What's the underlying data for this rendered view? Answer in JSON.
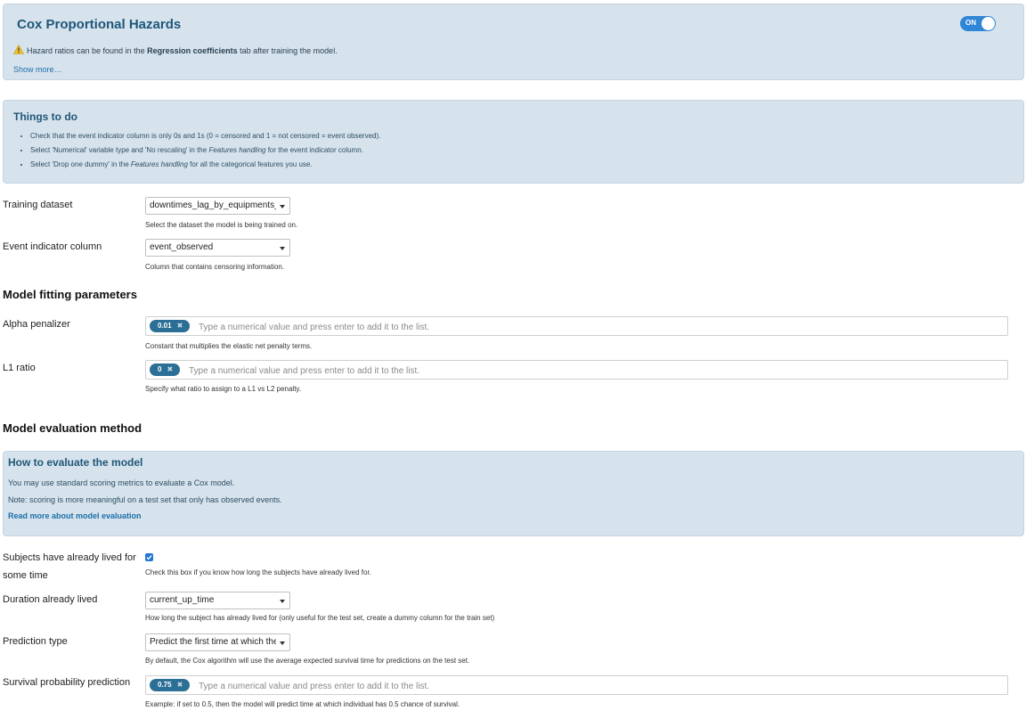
{
  "header": {
    "title": "Cox Proportional Hazards",
    "toggle_label": "ON",
    "warning_before": "Hazard ratios can be found in the ",
    "warning_bold": "Regression coefficients",
    "warning_after": " tab after training the model.",
    "show_more": "Show more…"
  },
  "todo": {
    "title": "Things to do",
    "items": [
      {
        "text": "Check that the event indicator column is only 0s and 1s (0 = censored and 1 = not censored = event observed)."
      },
      {
        "before": "Select 'Numerical' variable type and 'No rescaling' in the ",
        "em": "Features handling",
        "after": " for the event indicator column."
      },
      {
        "before": "Select 'Drop one dummy' in the ",
        "em": "Features handling",
        "after": " for all the categorical features you use."
      }
    ]
  },
  "training_dataset": {
    "label": "Training dataset",
    "value": "downtimes_lag_by_equipments_",
    "help": "Select the dataset the model is being trained on."
  },
  "event_indicator": {
    "label": "Event indicator column",
    "value": "event_observed",
    "help": "Column that contains censoring information."
  },
  "fitting": {
    "heading": "Model fitting parameters",
    "alpha": {
      "label": "Alpha penalizer",
      "chip": "0.01",
      "placeholder": "Type a numerical value and press enter to add it to the list.",
      "help": "Constant that multiplies the elastic net penalty terms."
    },
    "l1": {
      "label": "L1 ratio",
      "chip": "0",
      "placeholder": "Type a numerical value and press enter to add it to the list.",
      "help": "Specify what ratio to assign to a L1 vs L2 penalty."
    }
  },
  "evaluation": {
    "heading": "Model evaluation method",
    "box_title": "How to evaluate the model",
    "line1": "You may use standard scoring metrics to evaluate a Cox model.",
    "line2": "Note: scoring is more meaningful on a test set that only has observed events.",
    "link": "Read more about model evaluation"
  },
  "lived": {
    "label_line1": "Subjects have already lived for",
    "label_line2": "some time",
    "checked": true,
    "help": "Check this box if you know how long the subjects have already lived for."
  },
  "duration": {
    "label": "Duration already lived",
    "value": "current_up_time",
    "help": "How long the subject has already lived for (only useful for the test set, create a dummy column for the train set)"
  },
  "prediction_type": {
    "label": "Prediction type",
    "value": "Predict the first time at which the",
    "help": "By default, the Cox algorithm will use the average expected survival time for predictions on the test set."
  },
  "survival": {
    "label": "Survival probability prediction",
    "chip": "0.75",
    "placeholder": "Type a numerical value and press enter to add it to the list.",
    "help": "Example: if set to 0.5, then the model will predict time at which individual has 0.5 chance of survival."
  },
  "colors": {
    "panel_bg": "#d6e3ed",
    "title_blue": "#1f5678",
    "chip_bg": "#2c6f96",
    "toggle_on": "#2f86d6",
    "link_blue": "#1c6ea8"
  }
}
